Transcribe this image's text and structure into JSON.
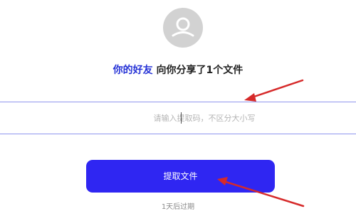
{
  "share": {
    "sender": "你的好友",
    "message": " 向你分享了1个文件"
  },
  "extract_code": {
    "value": "",
    "placeholder": "请输入提取码，不区分大小写"
  },
  "submit_label": "提取文件",
  "expiry_text": "1天后过期",
  "colors": {
    "accent": "#2f26f2",
    "sender_text": "#2633d6",
    "annotation_arrow": "#d62a2a",
    "avatar": "#d2d2d2"
  },
  "icons": {
    "avatar": "user-silhouette-icon",
    "annotation": "red-pointer-arrow"
  }
}
